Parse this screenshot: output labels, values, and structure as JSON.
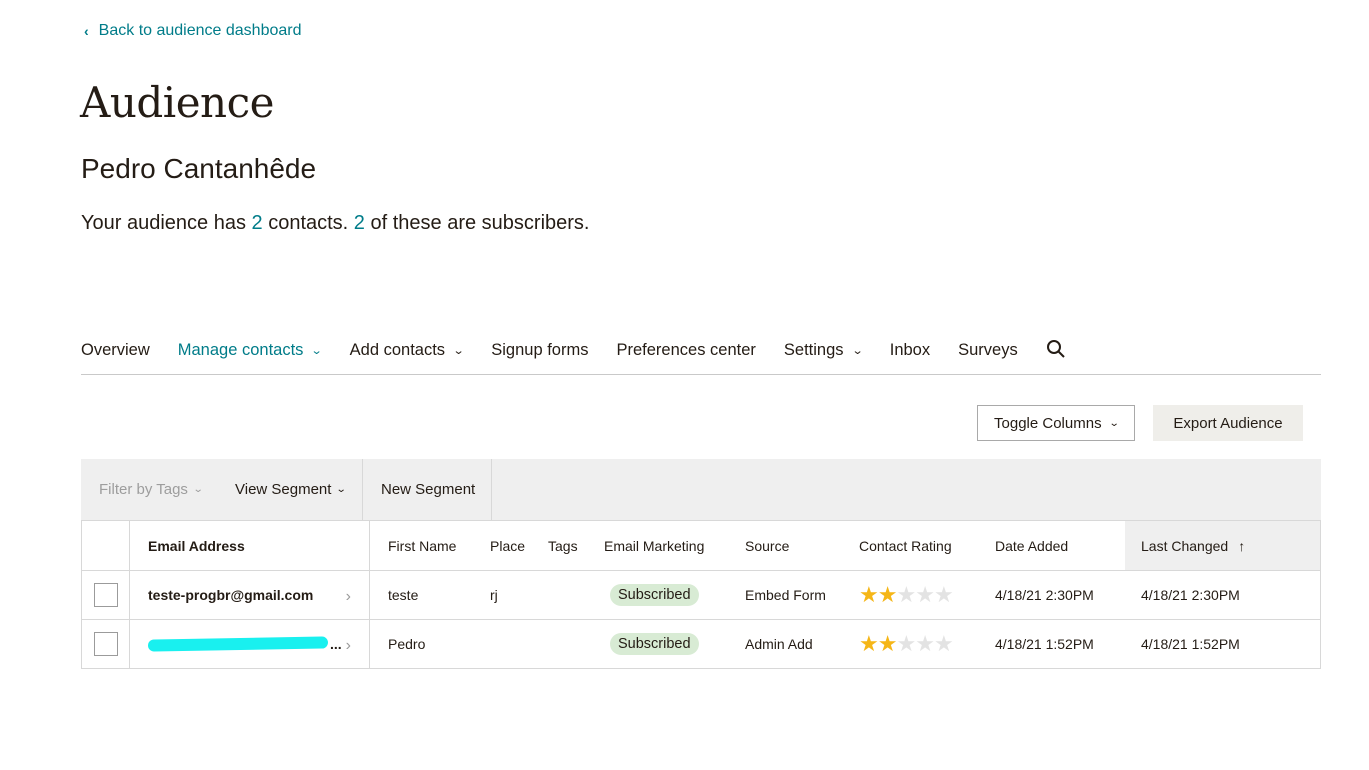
{
  "back_link": "Back to audience dashboard",
  "page_title": "Audience",
  "audience_name": "Pedro Cantanhêde",
  "summary": {
    "prefix": "Your audience has ",
    "contacts": "2",
    "middle": " contacts. ",
    "subscribers": "2",
    "suffix": " of these are subscribers."
  },
  "nav": {
    "items": [
      {
        "label": "Overview",
        "dropdown": false
      },
      {
        "label": "Manage contacts",
        "dropdown": true,
        "active": true
      },
      {
        "label": "Add contacts",
        "dropdown": true
      },
      {
        "label": "Signup forms",
        "dropdown": false
      },
      {
        "label": "Preferences center",
        "dropdown": false
      },
      {
        "label": "Settings",
        "dropdown": true
      },
      {
        "label": "Inbox",
        "dropdown": false
      },
      {
        "label": "Surveys",
        "dropdown": false
      }
    ],
    "search_icon": "search-icon"
  },
  "actions": {
    "toggle_columns": "Toggle Columns",
    "export_audience": "Export Audience"
  },
  "toolbar": {
    "filter_by_tags": "Filter by Tags",
    "view_segment": "View Segment",
    "new_segment": "New Segment"
  },
  "table": {
    "columns": {
      "email": "Email Address",
      "first_name": "First Name",
      "place": "Place",
      "tags": "Tags",
      "email_marketing": "Email Marketing",
      "source": "Source",
      "contact_rating": "Contact Rating",
      "date_added": "Date Added",
      "last_changed": "Last Changed",
      "sort_icon": "arrow-up-icon"
    },
    "rows": [
      {
        "email": "teste-progbr@gmail.com",
        "first_name": "teste",
        "place": "rj",
        "tags": "",
        "status": "Subscribed",
        "source": "Embed Form",
        "rating": 2,
        "rating_max": 5,
        "date_added": "4/18/21 2:30PM",
        "last_changed": "4/18/21 2:30PM"
      },
      {
        "email": "",
        "email_redacted": true,
        "ellipsis": "...",
        "first_name": "Pedro",
        "place": "",
        "tags": "",
        "status": "Subscribed",
        "source": "Admin Add",
        "rating": 2,
        "rating_max": 5,
        "date_added": "4/18/21 1:52PM",
        "last_changed": "4/18/21 1:52PM"
      }
    ]
  },
  "colors": {
    "accent": "#007c89",
    "text": "#241c15",
    "badge_bg": "#d8ebd4",
    "star_on": "#f5b617",
    "star_off": "#e3e3e3",
    "redaction": "#19f0ef"
  }
}
